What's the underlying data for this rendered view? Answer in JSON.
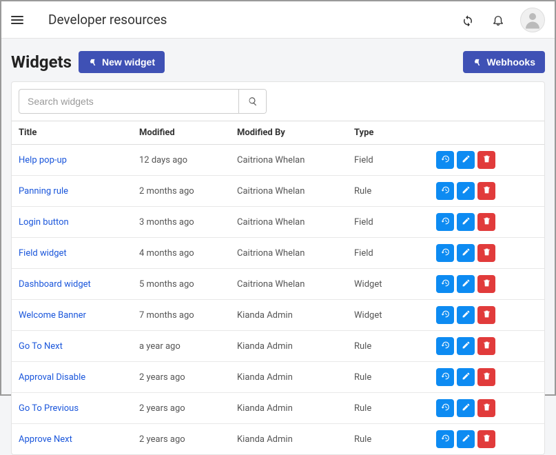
{
  "header": {
    "title": "Developer resources"
  },
  "page": {
    "title": "Widgets"
  },
  "buttons": {
    "new_widget": "New widget",
    "webhooks": "Webhooks"
  },
  "search": {
    "placeholder": "Search widgets"
  },
  "table": {
    "columns": {
      "title": "Title",
      "modified": "Modified",
      "modified_by": "Modified By",
      "type": "Type"
    },
    "rows": [
      {
        "title": "Help pop-up",
        "modified": "12 days ago",
        "modified_by": "Caitriona Whelan",
        "type": "Field"
      },
      {
        "title": "Panning rule",
        "modified": "2 months ago",
        "modified_by": "Caitriona Whelan",
        "type": "Rule"
      },
      {
        "title": "Login button",
        "modified": "3 months ago",
        "modified_by": "Caitriona Whelan",
        "type": "Field"
      },
      {
        "title": "Field widget",
        "modified": "4 months ago",
        "modified_by": "Caitriona Whelan",
        "type": "Field"
      },
      {
        "title": "Dashboard widget",
        "modified": "5 months ago",
        "modified_by": "Caitriona Whelan",
        "type": "Widget"
      },
      {
        "title": "Welcome Banner",
        "modified": "7 months ago",
        "modified_by": "Kianda Admin",
        "type": "Widget"
      },
      {
        "title": "Go To Next",
        "modified": "a year ago",
        "modified_by": "Kianda Admin",
        "type": "Rule"
      },
      {
        "title": "Approval Disable",
        "modified": "2 years ago",
        "modified_by": "Kianda Admin",
        "type": "Rule"
      },
      {
        "title": "Go To Previous",
        "modified": "2 years ago",
        "modified_by": "Kianda Admin",
        "type": "Rule"
      },
      {
        "title": "Approve Next",
        "modified": "2 years ago",
        "modified_by": "Kianda Admin",
        "type": "Rule"
      }
    ]
  }
}
